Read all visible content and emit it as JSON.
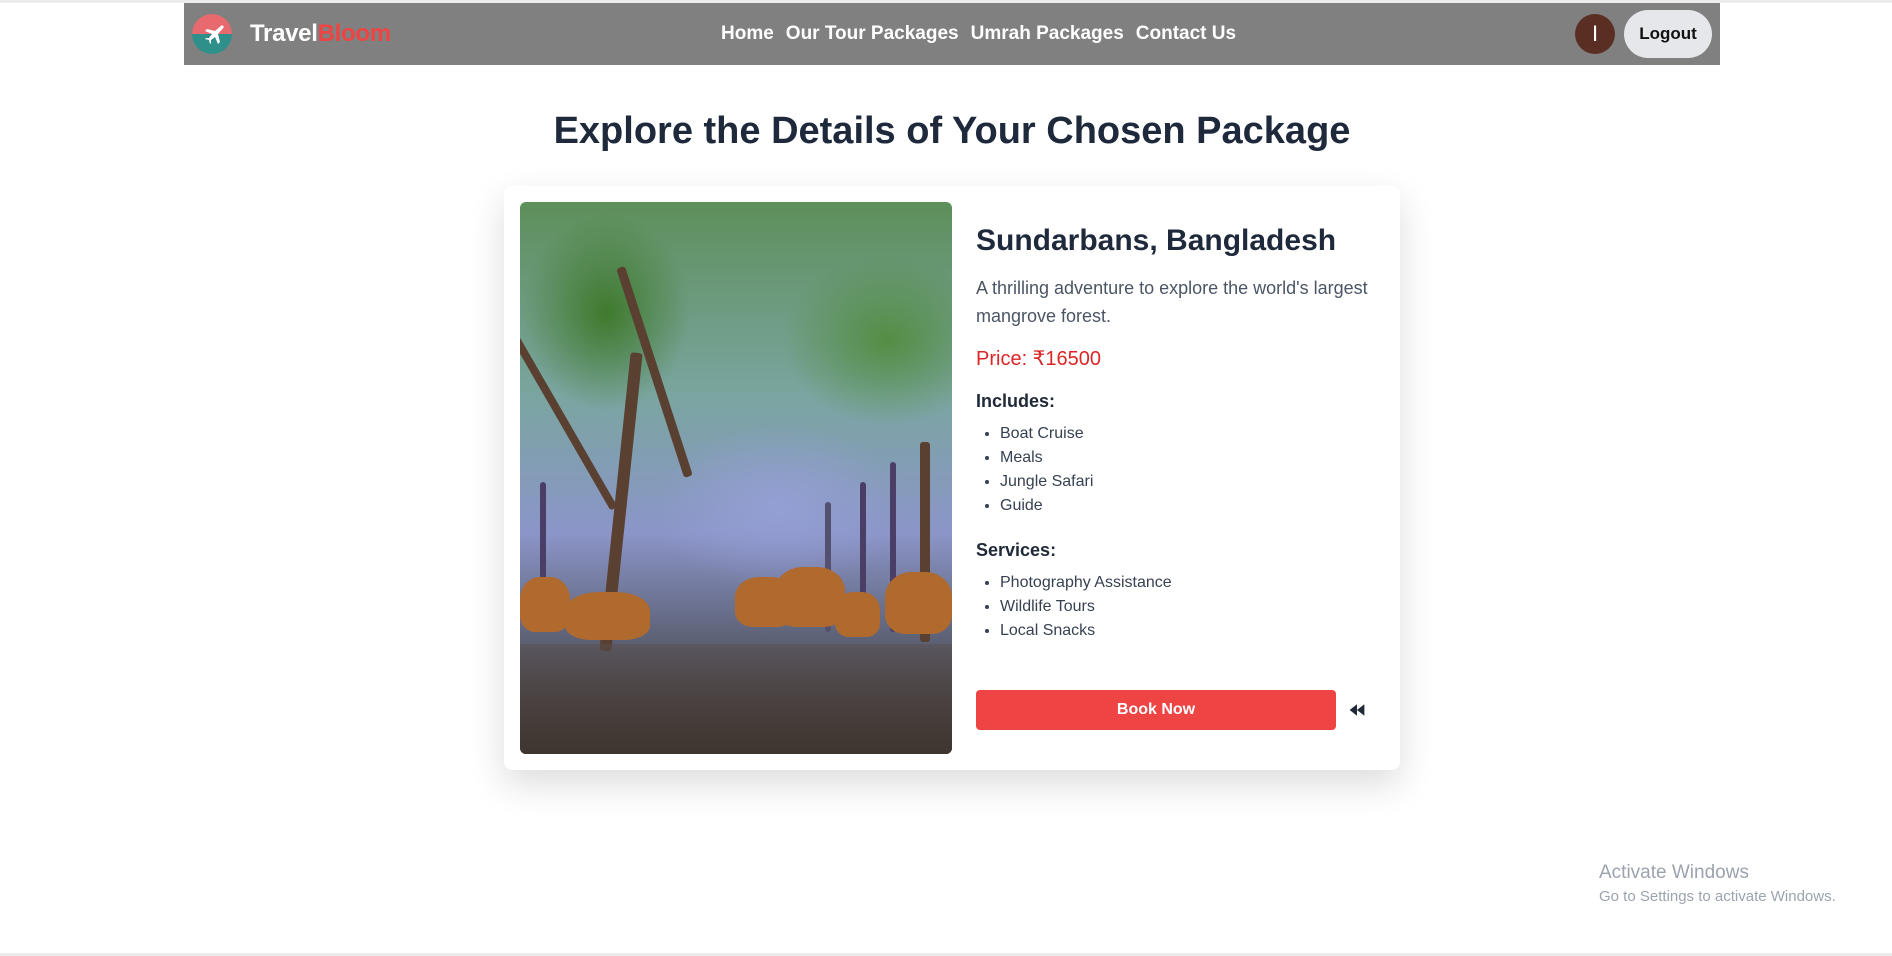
{
  "header": {
    "brand_part1": "Travel",
    "brand_part2": "Bloom",
    "nav": [
      {
        "label": "Home"
      },
      {
        "label": "Our Tour Packages"
      },
      {
        "label": "Umrah Packages"
      },
      {
        "label": "Contact Us"
      }
    ],
    "avatar_initial": "I",
    "logout_label": "Logout"
  },
  "main": {
    "title": "Explore the Details of Your Chosen Package",
    "package": {
      "name": "Sundarbans, Bangladesh",
      "description": "A thrilling adventure to explore the world's largest mangrove forest.",
      "price": "Price: ₹16500",
      "includes_heading": "Includes:",
      "includes": [
        "Boat Cruise",
        "Meals",
        "Jungle Safari",
        "Guide"
      ],
      "services_heading": "Services:",
      "services": [
        "Photography Assistance",
        "Wildlife Tours",
        "Local Snacks"
      ],
      "book_label": "Book Now",
      "back_icon": "back-arrow-icon"
    }
  },
  "watermark": {
    "title": "Activate Windows",
    "subtitle": "Go to Settings to activate Windows."
  },
  "colors": {
    "navbar": "#808080",
    "accent": "#ef4444",
    "price": "#dc2626",
    "heading": "#1e293b"
  }
}
